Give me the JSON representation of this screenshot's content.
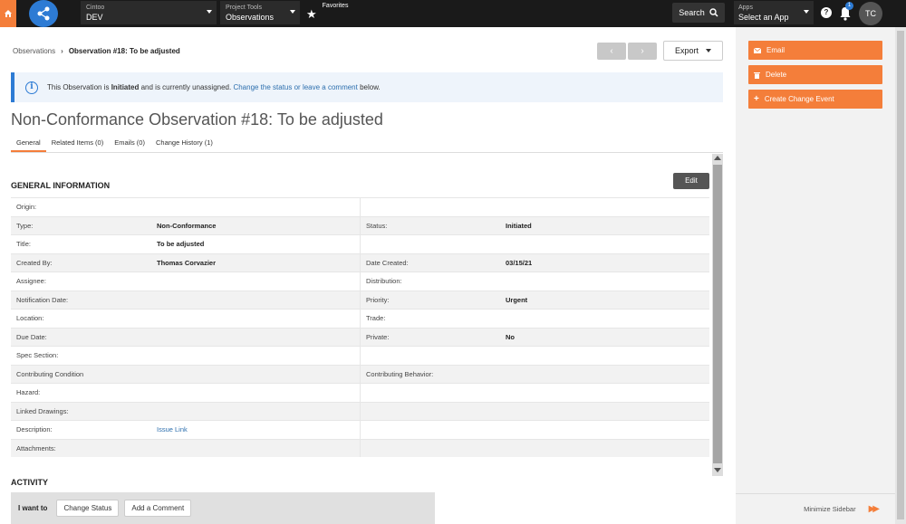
{
  "topbar": {
    "project_label": "Cintoo",
    "project_value": "DEV",
    "tools_label": "Project Tools",
    "tools_value": "Observations",
    "favorites_label": "Favorites",
    "search_label": "Search",
    "apps_label": "Apps",
    "apps_value": "Select an App",
    "notification_count": "1",
    "avatar_initials": "TC"
  },
  "breadcrumb": {
    "parent": "Observations",
    "current": "Observation #18: To be adjusted"
  },
  "toolbar": {
    "prev": "‹",
    "next": "›",
    "export_label": "Export"
  },
  "alert": {
    "prefix": "This Observation is ",
    "status": "Initiated",
    "middle": " and is currently unassigned. ",
    "link1": "Change the status",
    "or": " or ",
    "link2": "leave a comment",
    "suffix": " below."
  },
  "page_title": "Non-Conformance Observation #18: To be adjusted",
  "tabs": [
    {
      "label": "General"
    },
    {
      "label": "Related Items (0)"
    },
    {
      "label": "Emails (0)"
    },
    {
      "label": "Change History (1)"
    }
  ],
  "section": {
    "title": "GENERAL INFORMATION",
    "edit_label": "Edit"
  },
  "fields": [
    {
      "l1": "Origin:",
      "v1": "",
      "l2": "",
      "v2": ""
    },
    {
      "l1": "Type:",
      "v1": "Non-Conformance",
      "l2": "Status:",
      "v2": "Initiated"
    },
    {
      "l1": "Title:",
      "v1": "To be adjusted",
      "l2": "",
      "v2": ""
    },
    {
      "l1": "Created By:",
      "v1": "Thomas Corvazier",
      "l2": "Date Created:",
      "v2": "03/15/21"
    },
    {
      "l1": "Assignee:",
      "v1": "",
      "l2": "Distribution:",
      "v2": ""
    },
    {
      "l1": "Notification Date:",
      "v1": "",
      "l2": "Priority:",
      "v2": "Urgent"
    },
    {
      "l1": "Location:",
      "v1": "",
      "l2": "Trade:",
      "v2": ""
    },
    {
      "l1": "Due Date:",
      "v1": "",
      "l2": "Private:",
      "v2": "No"
    },
    {
      "l1": "Spec Section:",
      "v1": "",
      "l2": "",
      "v2": ""
    },
    {
      "l1": "Contributing Condition",
      "v1": "",
      "l2": "Contributing Behavior:",
      "v2": ""
    },
    {
      "l1": "Hazard:",
      "v1": "",
      "l2": "",
      "v2": ""
    },
    {
      "l1": "Linked Drawings:",
      "v1": "",
      "l2": "",
      "v2": ""
    },
    {
      "l1": "Description:",
      "v1": "Issue Link",
      "l2": "",
      "v2": ""
    },
    {
      "l1": "Attachments:",
      "v1": "",
      "l2": "",
      "v2": ""
    }
  ],
  "activity": {
    "title": "ACTIVITY",
    "i_want_to": "I want to",
    "change_status": "Change Status",
    "add_comment": "Add a Comment"
  },
  "sidebar": {
    "email": "Email",
    "delete": "Delete",
    "create_change_event": "Create Change Event",
    "minimize": "Minimize Sidebar"
  },
  "colors": {
    "accent": "#f47e3a",
    "brand_blue": "#2d7bd4",
    "topbar": "#1a1a1a"
  }
}
